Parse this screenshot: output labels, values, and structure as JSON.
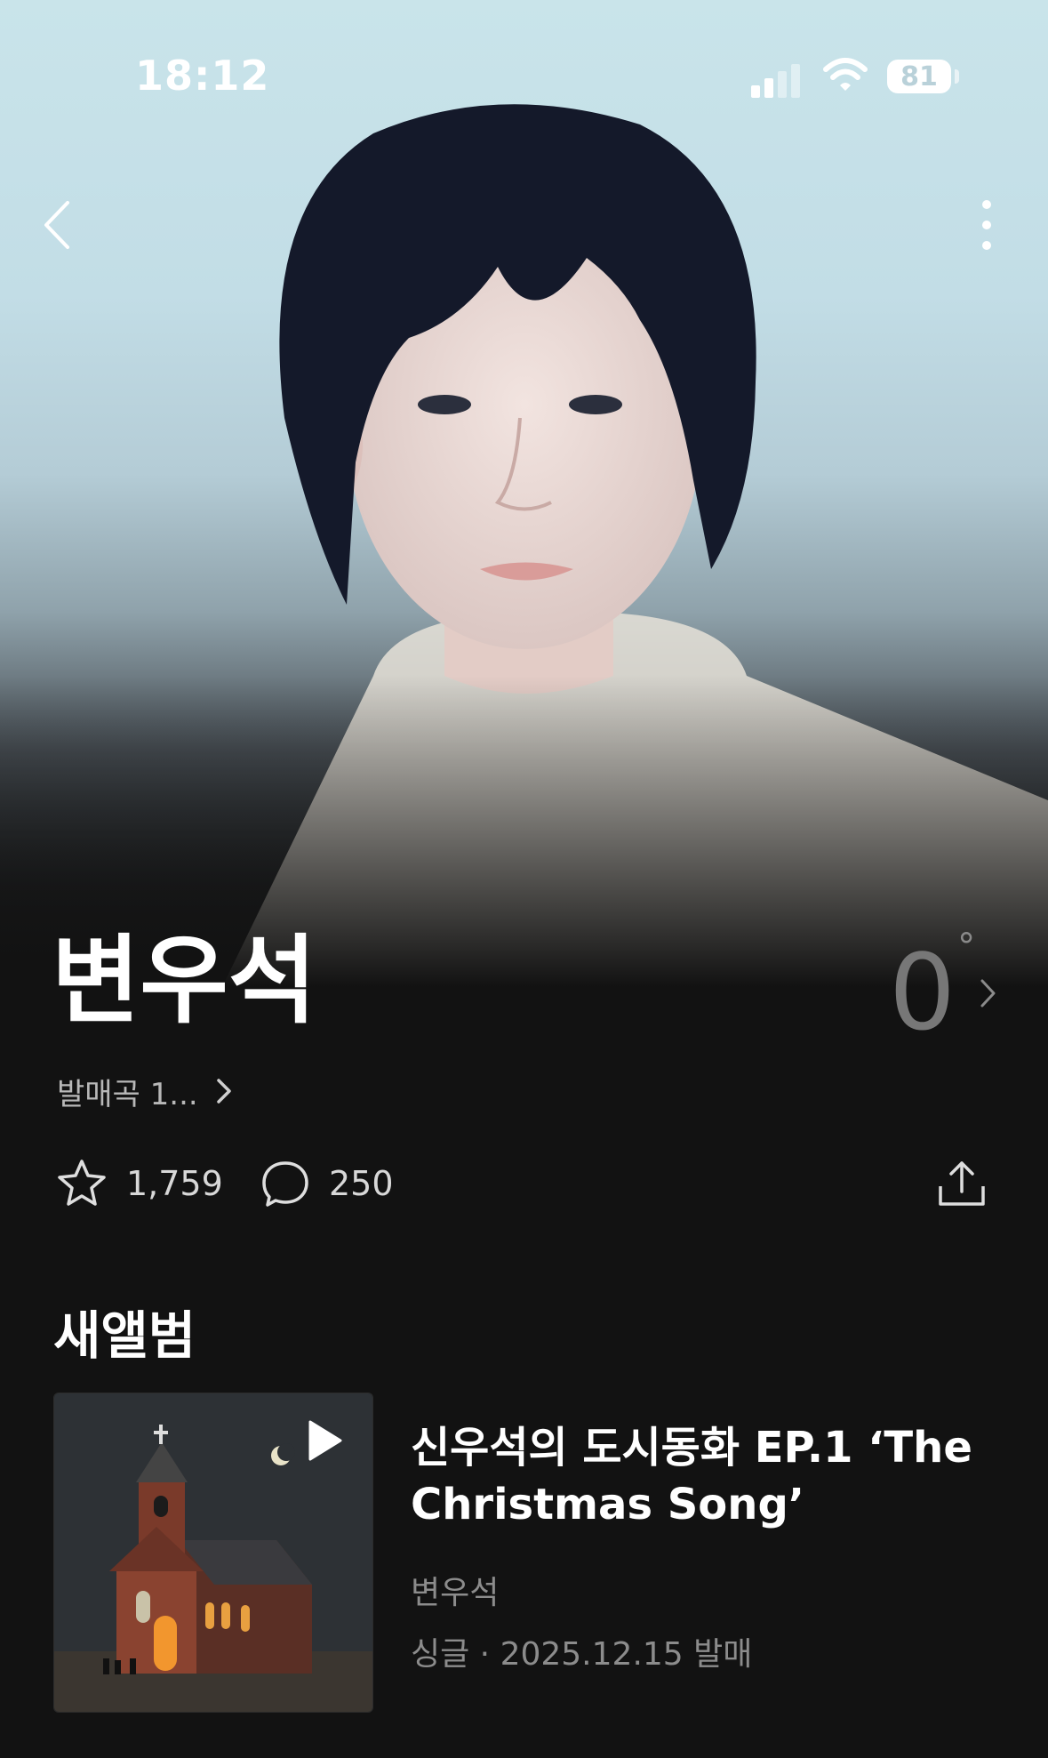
{
  "status_bar": {
    "time": "18:12",
    "battery_level": "81",
    "signal_icon": "cellular-signal-icon",
    "wifi_icon": "wifi-icon"
  },
  "header": {
    "back_icon": "chevron-left-icon",
    "more_icon": "more-vertical-icon"
  },
  "artist": {
    "name": "변우석",
    "temperature": "0",
    "temperature_unit": "°",
    "info_link": "발매곡 1..."
  },
  "actions": {
    "likes": "1,759",
    "comments": "250",
    "like_icon": "star-icon",
    "comment_icon": "speech-bubble-icon",
    "share_icon": "share-upload-icon"
  },
  "new_album": {
    "section_title": "새앨범",
    "title": "신우석의 도시동화 EP.1 ‘The Christmas Song’",
    "artist": "변우석",
    "meta": "싱글 · 2025.12.15 발매",
    "play_icon": "play-icon"
  },
  "colors": {
    "background": "#121212",
    "hero_top": "#c9e4ea",
    "muted_text": "#8c8c8c",
    "temperature": "#777777"
  }
}
